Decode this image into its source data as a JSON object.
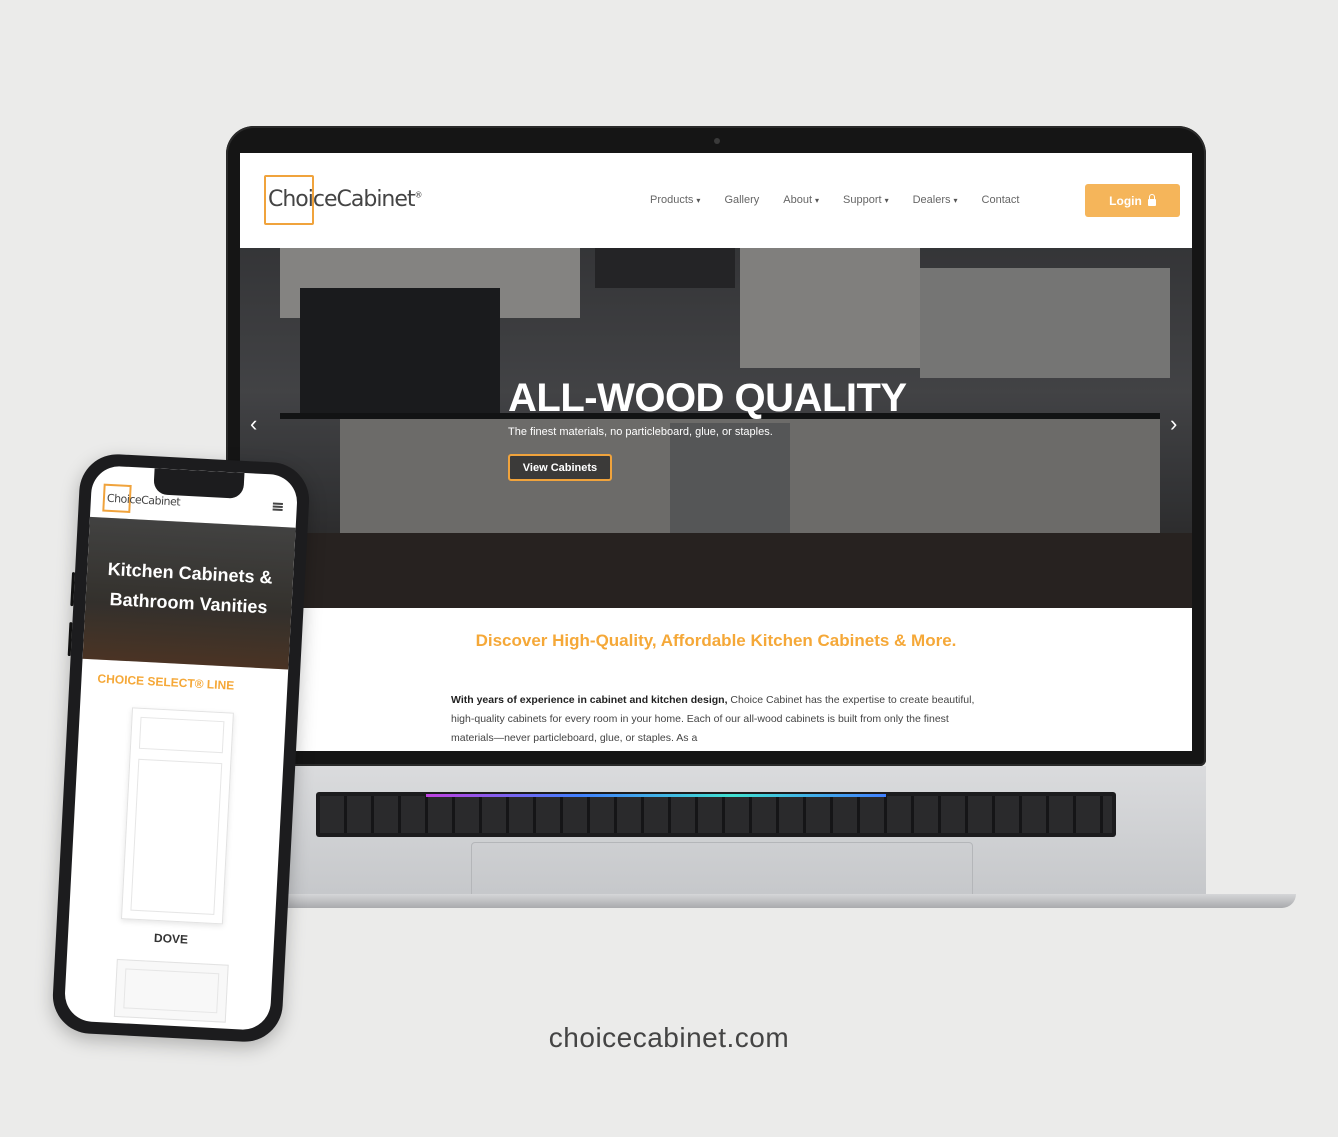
{
  "site": {
    "logo_text": "ChoiceCabinet",
    "logo_mark": "®",
    "nav": [
      {
        "label": "Products",
        "dropdown": true
      },
      {
        "label": "Gallery",
        "dropdown": false
      },
      {
        "label": "About",
        "dropdown": true
      },
      {
        "label": "Support",
        "dropdown": true
      },
      {
        "label": "Dealers",
        "dropdown": true
      },
      {
        "label": "Contact",
        "dropdown": false
      }
    ],
    "login_label": "Login",
    "hero": {
      "title": "ALL-WOOD QUALITY",
      "subtitle": "The finest materials, no particleboard, glue, or staples.",
      "button_label": "View Cabinets"
    },
    "section_heading": "Discover High-Quality, Affordable Kitchen Cabinets & More.",
    "section_body_bold": "With years of experience in cabinet and kitchen design,",
    "section_body_rest": " Choice Cabinet has the expertise to create beautiful, high-quality cabinets for every room in your home. Each of our all-wood cabinets is built from only the finest materials—never particleboard, glue, or staples. As a"
  },
  "mobile": {
    "logo_text": "ChoiceCabinet",
    "hero_title_line1": "Kitchen Cabinets &",
    "hero_title_line2": "Bathroom Vanities",
    "section_label": "CHOICE SELECT® LINE",
    "door_label": "DOVE"
  },
  "caption": "choicecabinet.com",
  "colors": {
    "accent": "#f5a838",
    "login_bg": "#f5b55a",
    "background": "#ebebea"
  }
}
